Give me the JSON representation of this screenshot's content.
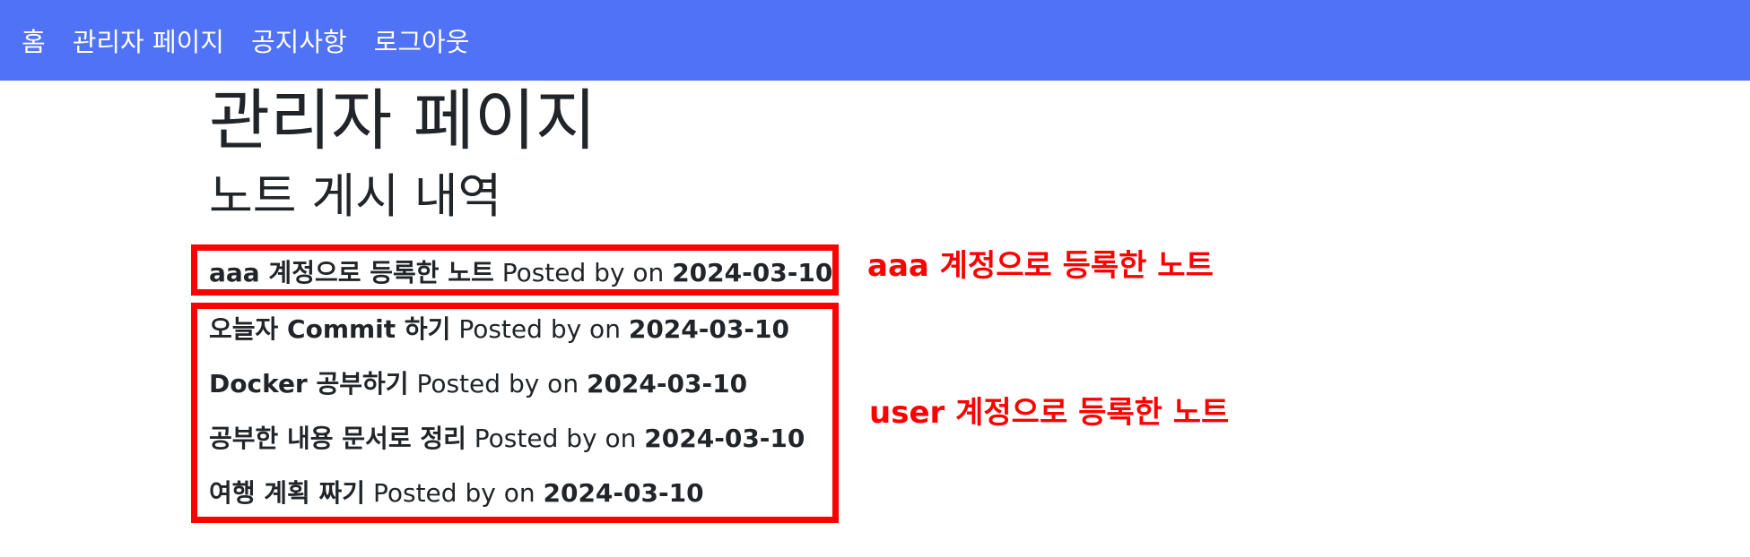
{
  "nav": {
    "items": [
      {
        "label": "홈"
      },
      {
        "label": "관리자 페이지"
      },
      {
        "label": "공지사항"
      },
      {
        "label": "로그아웃"
      }
    ]
  },
  "page": {
    "title": "관리자 페이지",
    "section_title": "노트 게시 내역"
  },
  "notes": [
    {
      "title": "aaa 계정으로 등록한 노트",
      "posted_by_text": "Posted by on",
      "date": "2024-03-10"
    },
    {
      "title": "오늘자 Commit 하기",
      "posted_by_text": "Posted by on",
      "date": "2024-03-10"
    },
    {
      "title": "Docker 공부하기",
      "posted_by_text": "Posted by on",
      "date": "2024-03-10"
    },
    {
      "title": "공부한 내용 문서로 정리",
      "posted_by_text": "Posted by on",
      "date": "2024-03-10"
    },
    {
      "title": "여행 계획 짜기",
      "posted_by_text": "Posted by on",
      "date": "2024-03-10"
    }
  ],
  "annotations": {
    "aaa_label": "aaa 계정으로 등록한 노트",
    "user_label": "user 계정으로 등록한 노트",
    "color": "#ff0000"
  },
  "colors": {
    "navbar_bg": "#4f72f7",
    "text": "#212529",
    "highlight_border": "#ff0000"
  }
}
